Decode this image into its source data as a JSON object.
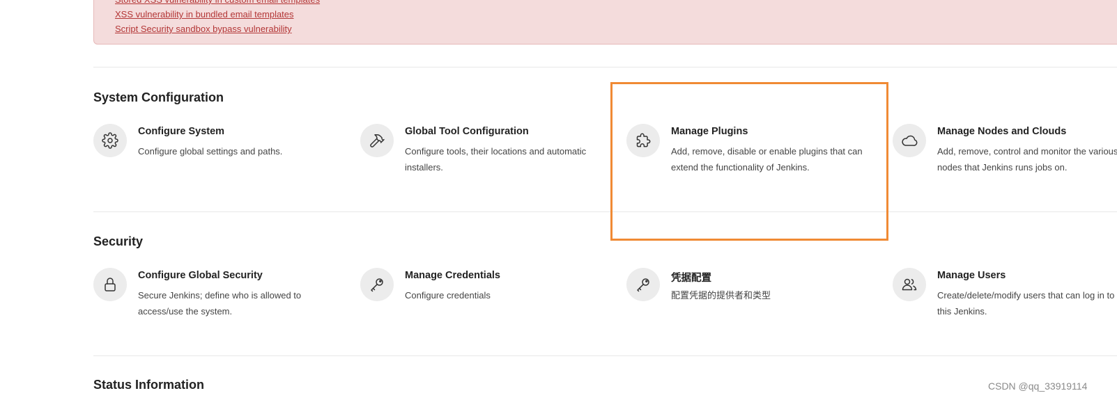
{
  "alert": {
    "links": [
      "Stored XSS vulnerability in custom email templates",
      "XSS vulnerability in bundled email templates",
      "Script Security sandbox bypass vulnerability"
    ]
  },
  "sections": [
    {
      "title": "System Configuration",
      "items": [
        {
          "icon": "gear-icon",
          "title": "Configure System",
          "desc": "Configure global settings and paths."
        },
        {
          "icon": "hammer-icon",
          "title": "Global Tool Configuration",
          "desc": "Configure tools, their locations and automatic installers."
        },
        {
          "icon": "puzzle-icon",
          "title": "Manage Plugins",
          "desc": "Add, remove, disable or enable plugins that can extend the functionality of Jenkins."
        },
        {
          "icon": "cloud-icon",
          "title": "Manage Nodes and Clouds",
          "desc": "Add, remove, control and monitor the various nodes that Jenkins runs jobs on."
        }
      ]
    },
    {
      "title": "Security",
      "items": [
        {
          "icon": "lock-icon",
          "title": "Configure Global Security",
          "desc": "Secure Jenkins; define who is allowed to access/use the system."
        },
        {
          "icon": "key-icon",
          "title": "Manage Credentials",
          "desc": "Configure credentials"
        },
        {
          "icon": "key-icon",
          "title": "凭据配置",
          "desc": "配置凭据的提供者和类型"
        },
        {
          "icon": "users-icon",
          "title": "Manage Users",
          "desc": "Create/delete/modify users that can log in to this Jenkins."
        }
      ]
    },
    {
      "title": "Status Information",
      "items": []
    }
  ],
  "watermark": "CSDN @qq_33919114",
  "colors": {
    "alert_bg": "#f4dcdc",
    "alert_link": "#b33636",
    "highlight": "#f08a34",
    "icon_bg": "#ececec"
  }
}
